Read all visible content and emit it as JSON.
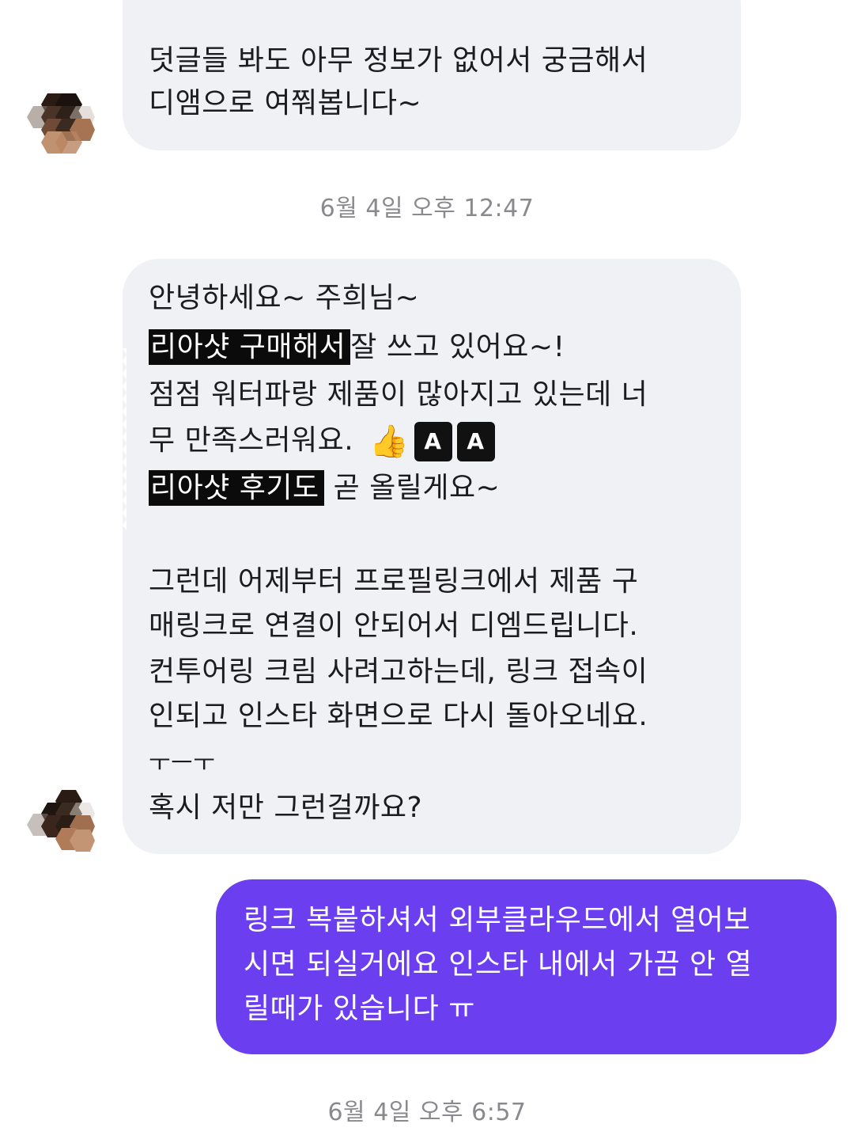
{
  "messages": [
    {
      "from": "other",
      "lines": [
        "덧글들 봐도 아무 정보가 없어서 궁금해서",
        "디앰으로 여쭤봅니다~"
      ]
    },
    {
      "from": "other",
      "line1": "안녕하세요~ 주희님~",
      "line2_redacted": "리아샷 구매해서",
      "line2_rest": "잘 쓰고 있어요~!",
      "line3": "점점 워터파랑 제품이 많아지고 있는데 너",
      "line4": "무 만족스러워요.",
      "emoji_thumb": "👍",
      "box_icon_1": "A",
      "box_icon_2": "A",
      "line5_redacted": "리아샷 후기도",
      "line5_rest": "곧 올릴게요~",
      "line6": "그런데 어제부터 프로필링크에서 제품 구",
      "line7": "매링크로 연결이 안되어서 디엠드립니다.",
      "line8": "컨투어링 크림 사려고하는데, 링크 접속이",
      "line9": "인되고 인스타 화면으로 다시 돌아오네요.",
      "line10": "ㅜㅡㅜ",
      "line11": "혹시 저만 그런걸까요?"
    },
    {
      "from": "me",
      "lines": [
        "링크 복붙하셔서 외부클라우드에서 열어보",
        "시면 되실거에요 인스타 내에서 가끔 안 열",
        "릴때가 있습니다 ㅠ"
      ]
    }
  ],
  "timestamps": [
    "6월 4일 오후 12:47",
    "6월 4일 오후 6:57"
  ],
  "colors": {
    "incoming_bubble": "#eff1f5",
    "outgoing_bubble": "#6b3ff0",
    "timestamp_text": "#8a8a8e"
  }
}
